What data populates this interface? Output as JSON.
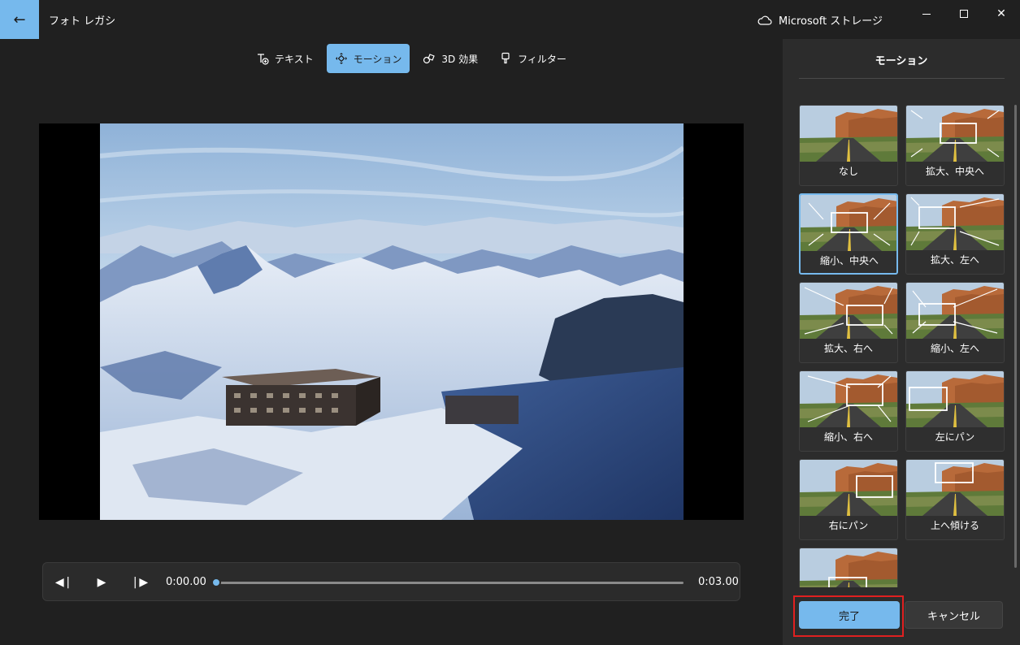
{
  "app": {
    "title": "フォト レガシ",
    "storage_label": "Microsoft ストレージ"
  },
  "toolbar": {
    "items": [
      {
        "label": "テキスト",
        "icon": "text-add-icon"
      },
      {
        "label": "モーション",
        "icon": "motion-icon"
      },
      {
        "label": "3D 効果",
        "icon": "3d-effects-icon"
      },
      {
        "label": "フィルター",
        "icon": "filter-icon"
      }
    ],
    "active": "モーション"
  },
  "player": {
    "current_time": "0:00.00",
    "total_time": "0:03.00",
    "progress": 0
  },
  "panel": {
    "title": "モーション",
    "options": [
      {
        "label": "なし"
      },
      {
        "label": "拡大、中央へ"
      },
      {
        "label": "縮小、中央へ",
        "selected": true
      },
      {
        "label": "拡大、左へ"
      },
      {
        "label": "拡大、右へ"
      },
      {
        "label": "縮小、左へ"
      },
      {
        "label": "縮小、右へ"
      },
      {
        "label": "左にパン"
      },
      {
        "label": "右にパン"
      },
      {
        "label": "上へ傾ける"
      },
      {
        "label": ""
      }
    ],
    "done_label": "完了",
    "cancel_label": "キャンセル"
  },
  "colors": {
    "accent": "#76b9ed",
    "background": "#202020",
    "panel": "#2c2c2c",
    "highlight_outline": "#e02020"
  }
}
